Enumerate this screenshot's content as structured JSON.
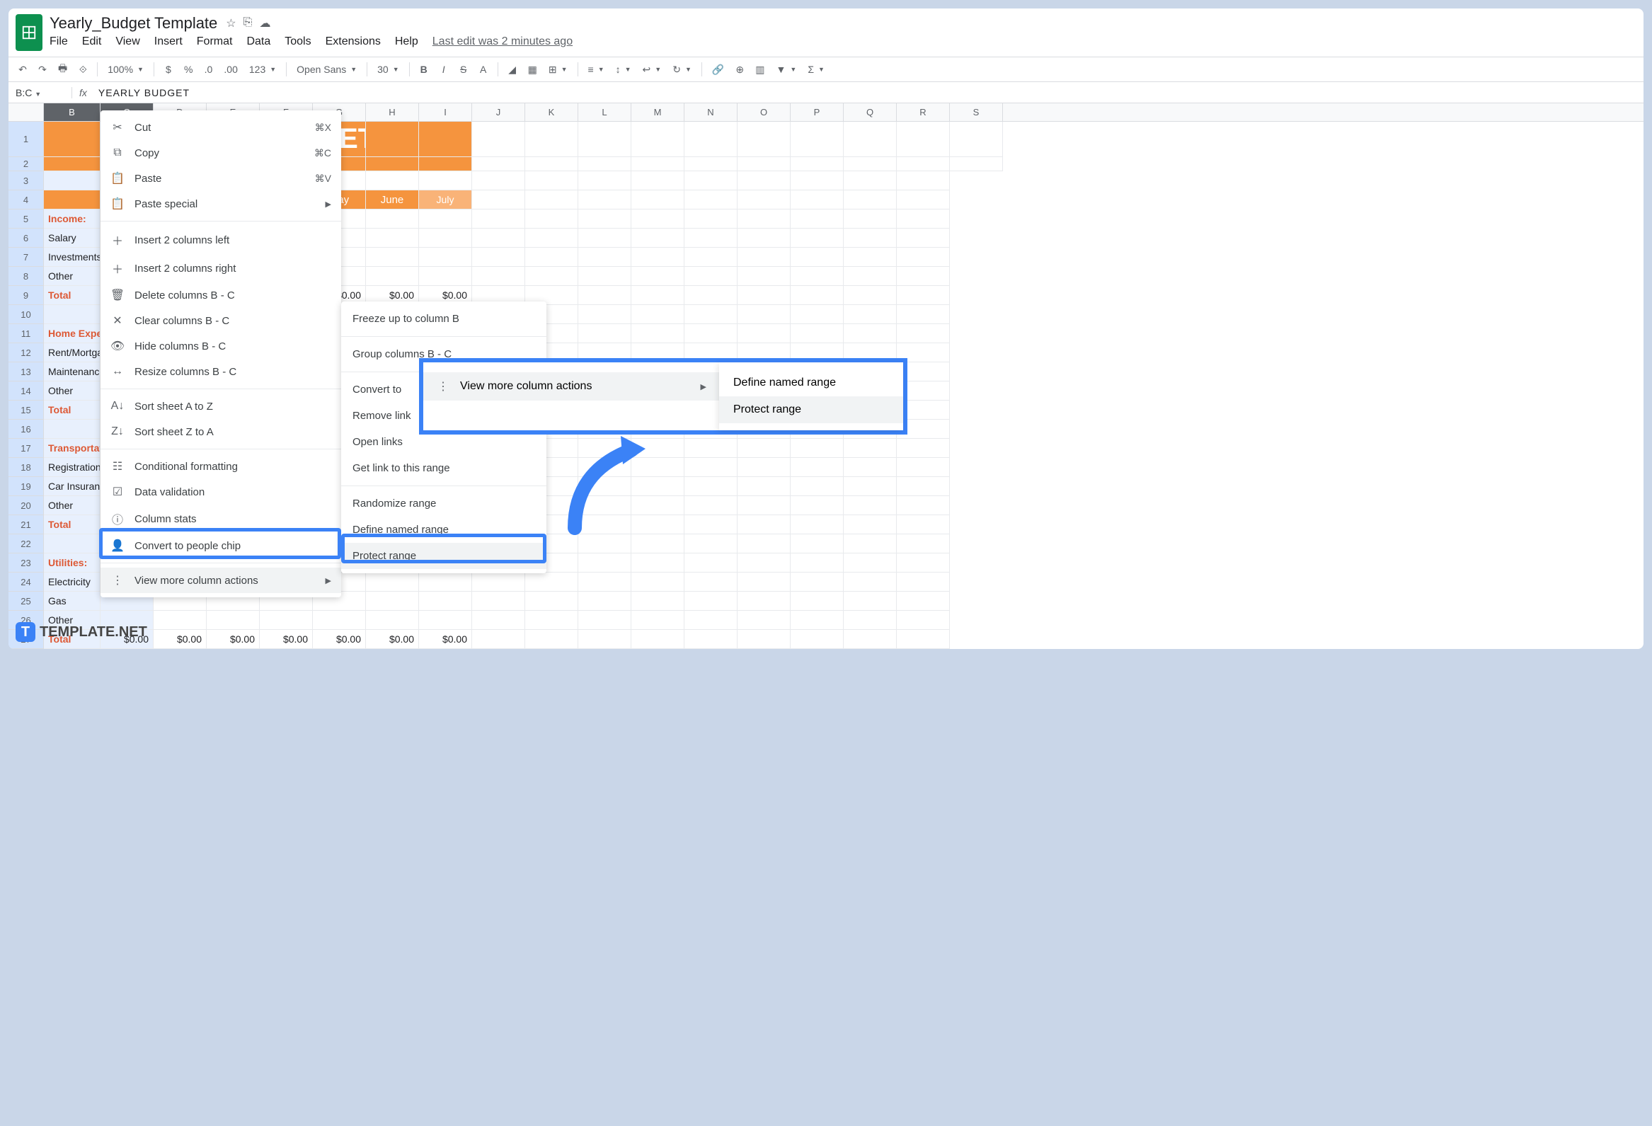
{
  "doc": {
    "title": "Yearly_Budget Template",
    "last_edit": "Last edit was 2 minutes ago"
  },
  "menus": {
    "file": "File",
    "edit": "Edit",
    "view": "View",
    "insert": "Insert",
    "format": "Format",
    "data": "Data",
    "tools": "Tools",
    "extensions": "Extensions",
    "help": "Help"
  },
  "toolbar": {
    "zoom": "100%",
    "currency": "$",
    "percent": "%",
    "dec_dec": ".0",
    "inc_dec": ".00",
    "format_123": "123",
    "font": "Open Sans",
    "fontsize": "30",
    "bold": "B",
    "italic": "I",
    "strike": "S",
    "text_A": "A"
  },
  "formula": {
    "range": "B:C",
    "fx": "fx",
    "value": "YEARLY  BUDGET"
  },
  "columns": [
    "B",
    "C",
    "D",
    "E",
    "F",
    "G",
    "H",
    "I",
    "J",
    "K",
    "L",
    "M",
    "N",
    "O",
    "P",
    "Q",
    "R",
    "S"
  ],
  "months": {
    "may": "May",
    "june": "June",
    "july": "July"
  },
  "banner_fragment": "GET",
  "sections": {
    "income": "Income:",
    "salary": "Salary",
    "investments": "Investments",
    "other": "Other",
    "total": "Total",
    "home": "Home Expenses:",
    "rent": "Rent/Mortgage",
    "maintenance": "Maintenance",
    "transportation": "Transportation:",
    "registration": "Registration",
    "car_insurance": "Car Insurance",
    "utilities": "Utilities:",
    "electricity": "Electricity",
    "gas": "Gas"
  },
  "values": {
    "zero": "$0.00"
  },
  "context_menu": {
    "cut": "Cut",
    "copy": "Copy",
    "paste": "Paste",
    "paste_special": "Paste special",
    "insert_left": "Insert 2 columns left",
    "insert_right": "Insert 2 columns right",
    "delete": "Delete columns B - C",
    "clear": "Clear columns B - C",
    "hide": "Hide columns B - C",
    "resize": "Resize columns B - C",
    "sort_az": "Sort sheet A to Z",
    "sort_za": "Sort sheet Z to A",
    "cond_format": "Conditional formatting",
    "data_validation": "Data validation",
    "column_stats": "Column stats",
    "people_chip": "Convert to people chip",
    "view_more": "View more column actions",
    "sc_cut": "⌘X",
    "sc_copy": "⌘C",
    "sc_paste": "⌘V"
  },
  "submenu": {
    "freeze": "Freeze up to column B",
    "group": "Group columns B - C",
    "convert_to": "Convert to",
    "remove_link": "Remove link",
    "open_links": "Open links",
    "get_link": "Get link to this range",
    "randomize": "Randomize range",
    "define_named": "Define named range",
    "protect": "Protect range"
  },
  "callout": {
    "people_chip_partial": "Convert to people chip",
    "view_more": "View more column actions",
    "define_named": "Define named range",
    "protect": "Protect range"
  },
  "watermark": {
    "text": "TEMPLATE.NET",
    "t": "T"
  }
}
